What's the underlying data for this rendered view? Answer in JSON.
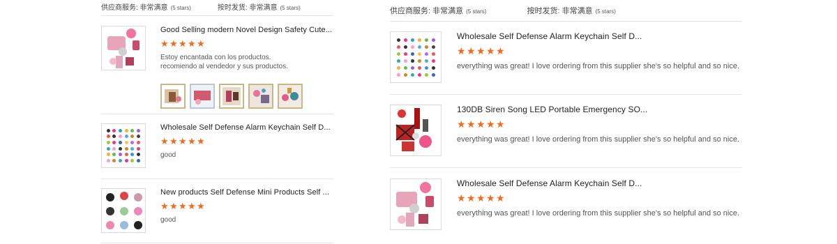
{
  "left": {
    "rating_header": {
      "service_label": "供应商服务: 非常满意",
      "service_stars": "(5 stars)",
      "delivery_label": "按时发货: 非常满意",
      "delivery_stars": "(5 stars)"
    },
    "reviews": [
      {
        "title": "Good Selling modern Novel Design Safety Cute...",
        "rating": 5,
        "text_line1": "Estoy encantada con los productos.",
        "text_line2": "recomiendo al vendedor y sus productos.",
        "photo_count": 5
      },
      {
        "title": "Wholesale Self Defense Alarm Keychain Self D...",
        "rating": 5,
        "text_line1": "good"
      },
      {
        "title": "New products Self Defense Mini Products Self ...",
        "rating": 5,
        "text_line1": "good"
      }
    ]
  },
  "right": {
    "rating_header": {
      "service_label": "供应商服务: 非常满意",
      "service_stars": "(5 stars)",
      "delivery_label": "按时发货: 非常满意",
      "delivery_stars": "(5 stars)"
    },
    "reviews": [
      {
        "title": "Wholesale Self Defense Alarm Keychain Self D...",
        "rating": 5,
        "text_line1": "everything was great! I love ordering from this supplier she's so helpful and so nice."
      },
      {
        "title": "130DB Siren Song LED Portable Emergency SO...",
        "rating": 5,
        "text_line1": "everything was great! I love ordering from this supplier she's so helpful and so nice."
      },
      {
        "title": "Wholesale Self Defense Alarm Keychain Self D...",
        "rating": 5,
        "text_line1": "everything was great! I love ordering from this supplier she's so helpful and so nice."
      }
    ]
  },
  "colors": {
    "star": "#f36a1a",
    "separator": "#e3e3e3"
  },
  "icons": {
    "rating_star": "star-icon"
  }
}
